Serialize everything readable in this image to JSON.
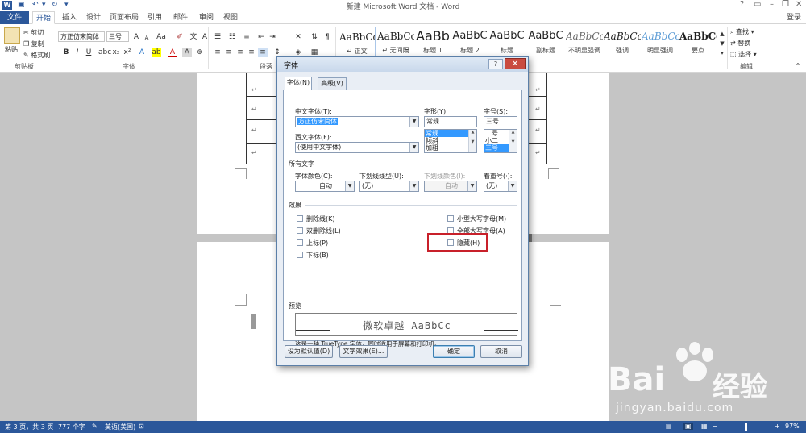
{
  "window": {
    "title": "新建 Microsoft Word 文档 - Word",
    "app_icon": "W",
    "help_glyph": "?",
    "login": "登录"
  },
  "tabs": {
    "file": "文件",
    "items": [
      "开始",
      "插入",
      "设计",
      "页面布局",
      "引用",
      "邮件",
      "审阅",
      "视图"
    ]
  },
  "ribbon": {
    "clipboard": {
      "paste": "粘贴",
      "cut": "剪切",
      "copy": "复制",
      "format_painter": "格式刷",
      "label": "剪贴板"
    },
    "font": {
      "font_name": "方正仿宋简体",
      "font_size": "三号",
      "label": "字体"
    },
    "paragraph": {
      "label": "段落"
    },
    "styles": [
      {
        "sample": "AaBbCc",
        "name": "↵ 正文"
      },
      {
        "sample": "AaBbCc",
        "name": "↵ 无间隔"
      },
      {
        "sample": "AaBb",
        "name": "标题 1"
      },
      {
        "sample": "AaBbC",
        "name": "标题 2"
      },
      {
        "sample": "AaBbC",
        "name": "标题"
      },
      {
        "sample": "AaBbC",
        "name": "副标题"
      },
      {
        "sample": "AaBbCc",
        "name": "不明显强调"
      },
      {
        "sample": "AaBbCc",
        "name": "强调"
      },
      {
        "sample": "AaBbCc",
        "name": "明显强调"
      },
      {
        "sample": "AaBbCc",
        "name": "要点"
      }
    ],
    "editing": {
      "find": "查找",
      "replace": "替换",
      "select": "选择",
      "label": "编辑"
    }
  },
  "document": {
    "return_mark": "↵"
  },
  "dialog": {
    "title": "字体",
    "close": "×",
    "tab_font": "字体(N)",
    "tab_advanced": "高级(V)",
    "cn_font_label": "中文字体(T):",
    "cn_font_value": "方正仿宋简体",
    "west_font_label": "西文字体(F):",
    "west_font_value": "(使用中文字体)",
    "style_label": "字形(Y):",
    "style_value": "常规",
    "style_options": [
      "常规",
      "倾斜",
      "加粗"
    ],
    "size_label": "字号(S):",
    "size_value": "三号",
    "size_options": [
      "二号",
      "小二",
      "三号"
    ],
    "all_text_label": "所有文字",
    "font_color_label": "字体颜色(C):",
    "font_color_value": "自动",
    "underline_label": "下划线线型(U):",
    "underline_value": "(无)",
    "underline_color_label": "下划线颜色(I):",
    "underline_color_value": "自动",
    "emphasis_label": "着重号(·):",
    "emphasis_value": "(无)",
    "effects_label": "效果",
    "effects_left": [
      "删除线(K)",
      "双删除线(L)",
      "上标(P)",
      "下标(B)"
    ],
    "effects_right": [
      "小型大写字母(M)",
      "全部大写字母(A)",
      "隐藏(H)"
    ],
    "preview_label": "预览",
    "preview_text": "微软卓越  AaBbCc",
    "note": "这是一种 TrueType 字体，同时适用于屏幕和打印机。",
    "btn_default": "设为默认值(D)",
    "btn_text_effects": "文字效果(E)...",
    "btn_ok": "确定",
    "btn_cancel": "取消"
  },
  "status": {
    "page": "第 3 页，共 3 页",
    "words": "777 个字",
    "language": "英语(美国)",
    "zoom": "97%"
  },
  "watermark": {
    "brand": "Bai",
    "brand_cn": "经验",
    "url": "jingyan.baidu.com"
  },
  "colors": {
    "accent": "#2b579a",
    "highlight": "#c8202a"
  }
}
